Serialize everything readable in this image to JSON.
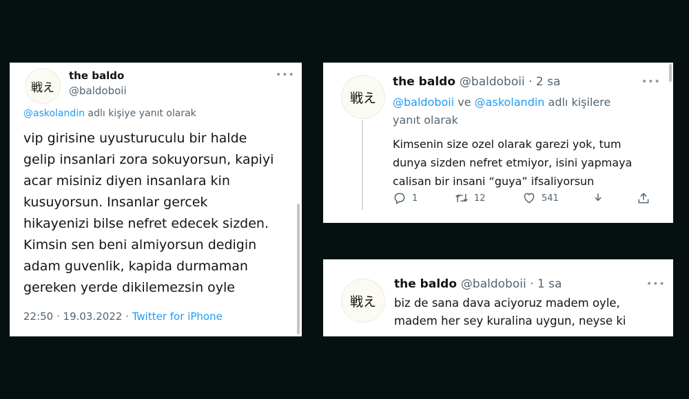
{
  "left_tweet": {
    "avatar_text": "戦え",
    "name": "the baldo",
    "handle": "@baldoboii",
    "more": "•••",
    "reply_mention": "@askolandin",
    "reply_suffix": "adlı kişiye yanıt olarak",
    "text": "vip girisine uyusturuculu bir halde\ngelip insanlari zora sokuyorsun, kapiyi\nacar misiniz diyen insanlara kin\nkusuyorsun. Insanlar gercek\nhikayenizi bilse nefret edecek sizden.\nKimsin sen beni almiyorsun dedigin\nadam guvenlik, kapida durmaman\ngereken yerde dikilemezsin oyle",
    "timestamp": "22:50 · 19.03.2022 · ",
    "source": "Twitter for iPhone"
  },
  "right_tweet_1": {
    "avatar_text": "戦え",
    "name": "the baldo",
    "handle": "@baldoboii · 2 sa",
    "more": "•••",
    "reply_mention_1": "@baldoboii",
    "reply_and": " ve ",
    "reply_mention_2": "@askolandin",
    "reply_suffix": " adlı kişilere\nyanıt olarak",
    "text": "Kimsenin size ozel olarak garezi yok, tum\ndunya sizden nefret etmiyor, isini yapmaya\ncalisan bir insani “guya” ifsaliyorsun",
    "actions": {
      "reply_count": "1",
      "retweet_count": "12",
      "like_count": "541",
      "reply_icon": "reply-icon",
      "retweet_icon": "retweet-icon",
      "like_icon": "heart-icon",
      "download_icon": "download-icon",
      "share_icon": "share-icon"
    }
  },
  "right_tweet_2": {
    "avatar_text": "戦え",
    "name": "the baldo",
    "handle": "@baldoboii · 1 sa",
    "more": "•••",
    "text": "biz de sana dava aciyoruz madem oyle,\nmadem her sey kuralina uygun, neyse ki"
  }
}
